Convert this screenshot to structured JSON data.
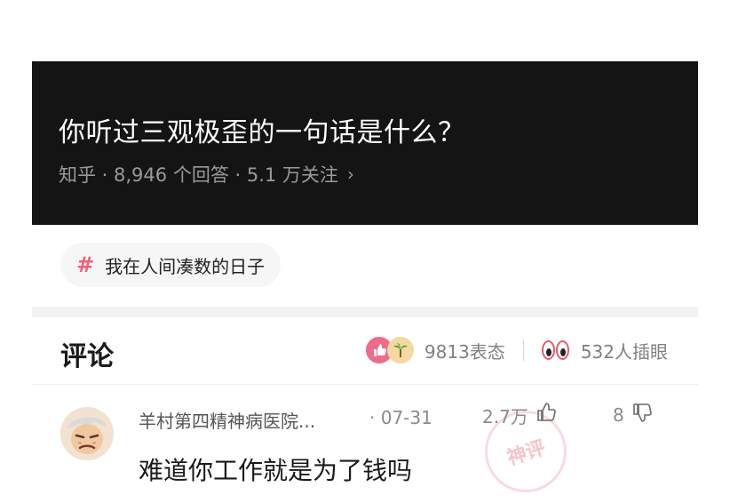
{
  "question": {
    "title": "你听过三观极歪的一句话是什么？",
    "meta": "知乎 · 8,946 个回答 · 5.1 万关注",
    "chevron": "›"
  },
  "topic": {
    "hash": "#",
    "label": "我在人间凑数的日子"
  },
  "comments_section": {
    "title": "评论",
    "reaction_count": "9813表态",
    "watch_count": "532人插眼"
  },
  "comment": {
    "author": "羊村第四精神病医院...",
    "date": "· 07-31",
    "likes": "2.7万",
    "dislikes": "8",
    "text": "难道你工作就是为了钱吗",
    "stamp": "神评"
  },
  "colors": {
    "card_bg": "#141414",
    "accent_pink": "#f06a8a",
    "hash_pink": "#f0607a"
  }
}
